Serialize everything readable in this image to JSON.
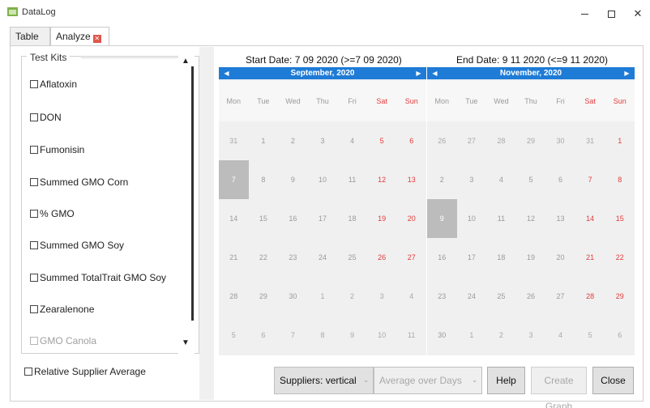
{
  "window": {
    "title": "DataLog",
    "minimize_icon": "minimize-icon",
    "maximize_icon": "maximize-icon",
    "close_glyph": "✕"
  },
  "tabs": [
    {
      "label": "Table",
      "active": false
    },
    {
      "label": "Analyze",
      "active": true,
      "close_icon": "tab-close-icon"
    }
  ],
  "test_kits": {
    "legend": "Test Kits",
    "items": [
      {
        "label": "Aflatoxin",
        "checked": false,
        "enabled": true
      },
      {
        "label": "DON",
        "checked": false,
        "enabled": true
      },
      {
        "label": "Fumonisin",
        "checked": false,
        "enabled": true
      },
      {
        "label": "Summed GMO Corn",
        "checked": false,
        "enabled": true
      },
      {
        "label": "% GMO",
        "checked": false,
        "enabled": true
      },
      {
        "label": "Summed GMO Soy",
        "checked": false,
        "enabled": true
      },
      {
        "label": "Summed TotalTrait GMO Soy",
        "checked": false,
        "enabled": true
      },
      {
        "label": "Zearalenone",
        "checked": false,
        "enabled": true
      },
      {
        "label": "GMO Canola",
        "checked": false,
        "enabled": false
      }
    ],
    "scroll_up_icon": "▲",
    "scroll_down_icon": "▼"
  },
  "relative_supplier_average": {
    "label": "Relative Supplier Average",
    "checked": false
  },
  "start": {
    "label": "Start Date: 7 09 2020 (>=7 09 2020)",
    "month_title": "September,  2020",
    "weekdays": [
      "Mon",
      "Tue",
      "Wed",
      "Thu",
      "Fri",
      "Sat",
      "Sun"
    ],
    "days": [
      "31",
      "1",
      "2",
      "3",
      "4",
      "5",
      "6",
      "7",
      "8",
      "9",
      "10",
      "11",
      "12",
      "13",
      "14",
      "15",
      "16",
      "17",
      "18",
      "19",
      "20",
      "21",
      "22",
      "23",
      "24",
      "25",
      "26",
      "27",
      "28",
      "29",
      "30",
      "1",
      "2",
      "3",
      "4",
      "5",
      "6",
      "7",
      "8",
      "9",
      "10",
      "11"
    ],
    "selected": "7"
  },
  "end": {
    "label": "End Date: 9 11 2020 (<=9 11 2020)",
    "month_title": "November,  2020",
    "weekdays": [
      "Mon",
      "Tue",
      "Wed",
      "Thu",
      "Fri",
      "Sat",
      "Sun"
    ],
    "days": [
      "26",
      "27",
      "28",
      "29",
      "30",
      "31",
      "1",
      "2",
      "3",
      "4",
      "5",
      "6",
      "7",
      "8",
      "9",
      "10",
      "11",
      "12",
      "13",
      "14",
      "15",
      "16",
      "17",
      "18",
      "19",
      "20",
      "21",
      "22",
      "23",
      "24",
      "25",
      "26",
      "27",
      "28",
      "29",
      "30",
      "1",
      "2",
      "3",
      "4",
      "5",
      "6"
    ],
    "selected": "9"
  },
  "controls": {
    "suppliers_value": "Suppliers: vertical",
    "average_value": "Average over Days",
    "dropdown_icon": "⌄",
    "help_label": "Help",
    "create_graph_label": "Create Graph",
    "close_label": "Close"
  },
  "colors": {
    "calendar_header": "#1e7bd6",
    "weekend_text": "#e33a3a",
    "selected_day": "#bcbcbc",
    "tab_close": "#e0554a"
  }
}
